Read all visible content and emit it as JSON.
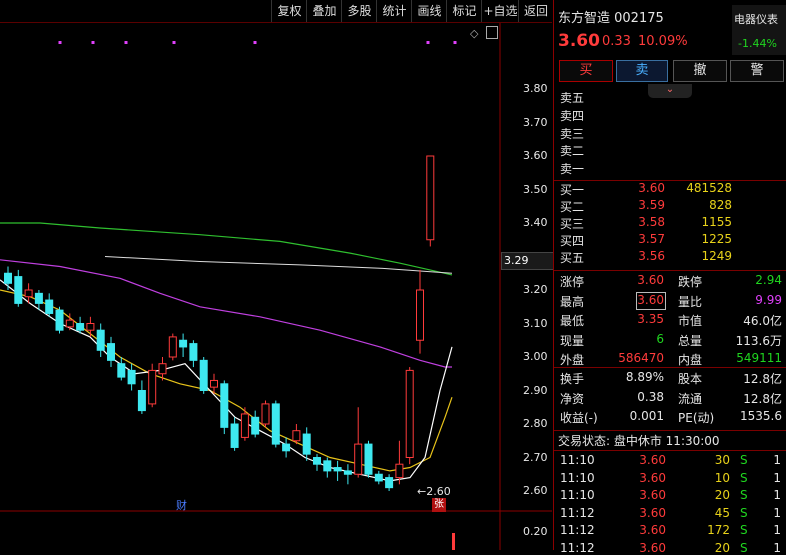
{
  "toolbar": {
    "items": [
      "复权",
      "叠加",
      "多股",
      "统计",
      "画线",
      "标记",
      "+自选",
      "返回"
    ]
  },
  "chart": {
    "yticks": [
      "3.80",
      "3.70",
      "3.60",
      "3.50",
      "3.40",
      "3.30",
      "3.20",
      "3.10",
      "3.00",
      "2.90",
      "2.80",
      "2.70",
      "2.60"
    ],
    "vol_tick": "0.20",
    "current_price_label": "3.29",
    "low_marker": "←2.60",
    "finance_tag": "财",
    "limit_tag": "张"
  },
  "stock": {
    "name": "东方智造 002175",
    "sector": "电器仪表",
    "sector_change": "-1.44%",
    "price": "3.60",
    "change": "0.33",
    "change_pct": "10.09%"
  },
  "buttons": {
    "buy": "买",
    "sell": "卖",
    "cancel": "撤",
    "alert": "警"
  },
  "sell_book": [
    {
      "label": "卖五",
      "price": "",
      "vol": ""
    },
    {
      "label": "卖四",
      "price": "",
      "vol": ""
    },
    {
      "label": "卖三",
      "price": "",
      "vol": ""
    },
    {
      "label": "卖二",
      "price": "",
      "vol": ""
    },
    {
      "label": "卖一",
      "price": "",
      "vol": ""
    }
  ],
  "buy_book": [
    {
      "label": "买一",
      "price": "3.60",
      "vol": "481528"
    },
    {
      "label": "买二",
      "price": "3.59",
      "vol": "828"
    },
    {
      "label": "买三",
      "price": "3.58",
      "vol": "1155"
    },
    {
      "label": "买四",
      "price": "3.57",
      "vol": "1225"
    },
    {
      "label": "买五",
      "price": "3.56",
      "vol": "1249"
    }
  ],
  "stats": [
    {
      "l1": "涨停",
      "v1": "3.60",
      "l2": "跌停",
      "v2": "2.94"
    },
    {
      "l1": "最高",
      "v1": "3.60",
      "l2": "量比",
      "v2": "9.99"
    },
    {
      "l1": "最低",
      "v1": "3.35",
      "l2": "市值",
      "v2": "46.0亿"
    },
    {
      "l1": "现量",
      "v1": "6",
      "l2": "总量",
      "v2": "113.6万"
    },
    {
      "l1": "外盘",
      "v1": "586470",
      "l2": "内盘",
      "v2": "549111"
    }
  ],
  "stats2": [
    {
      "l1": "换手",
      "v1": "8.89%",
      "l2": "股本",
      "v2": "12.8亿"
    },
    {
      "l1": "净资",
      "v1": "0.38",
      "l2": "流通",
      "v2": "12.8亿"
    },
    {
      "l1": "收益(-)",
      "v1": "0.001",
      "l2": "PE(动)",
      "v2": "1535.6"
    }
  ],
  "trade_status": "交易状态: 盘中休市 11:30:00",
  "ticks": [
    {
      "time": "11:10",
      "price": "3.60",
      "vol": "30",
      "side": "S",
      "n": "1"
    },
    {
      "time": "11:10",
      "price": "3.60",
      "vol": "10",
      "side": "S",
      "n": "1"
    },
    {
      "time": "11:10",
      "price": "3.60",
      "vol": "20",
      "side": "S",
      "n": "1"
    },
    {
      "time": "11:12",
      "price": "3.60",
      "vol": "45",
      "side": "S",
      "n": "1"
    },
    {
      "time": "11:12",
      "price": "3.60",
      "vol": "172",
      "side": "S",
      "n": "1"
    },
    {
      "time": "11:12",
      "price": "3.60",
      "vol": "20",
      "side": "S",
      "n": "1"
    }
  ],
  "chart_data": {
    "type": "candlestick",
    "ylim": [
      2.56,
      3.86
    ],
    "candles": [
      {
        "o": 3.25,
        "c": 3.22,
        "h": 3.27,
        "l": 3.2
      },
      {
        "o": 3.24,
        "c": 3.16,
        "h": 3.26,
        "l": 3.15
      },
      {
        "o": 3.18,
        "c": 3.2,
        "h": 3.22,
        "l": 3.16
      },
      {
        "o": 3.19,
        "c": 3.16,
        "h": 3.2,
        "l": 3.14
      },
      {
        "o": 3.17,
        "c": 3.13,
        "h": 3.19,
        "l": 3.12
      },
      {
        "o": 3.14,
        "c": 3.08,
        "h": 3.15,
        "l": 3.07
      },
      {
        "o": 3.09,
        "c": 3.11,
        "h": 3.13,
        "l": 3.08
      },
      {
        "o": 3.1,
        "c": 3.08,
        "h": 3.12,
        "l": 3.07
      },
      {
        "o": 3.08,
        "c": 3.1,
        "h": 3.12,
        "l": 3.06
      },
      {
        "o": 3.08,
        "c": 3.02,
        "h": 3.1,
        "l": 3.0
      },
      {
        "o": 3.04,
        "c": 2.99,
        "h": 3.06,
        "l": 2.97
      },
      {
        "o": 2.98,
        "c": 2.94,
        "h": 3.0,
        "l": 2.93
      },
      {
        "o": 2.96,
        "c": 2.92,
        "h": 2.98,
        "l": 2.9
      },
      {
        "o": 2.9,
        "c": 2.84,
        "h": 2.93,
        "l": 2.83
      },
      {
        "o": 2.86,
        "c": 2.96,
        "h": 2.98,
        "l": 2.85
      },
      {
        "o": 2.95,
        "c": 2.98,
        "h": 3.0,
        "l": 2.93
      },
      {
        "o": 3.0,
        "c": 3.06,
        "h": 3.07,
        "l": 2.99
      },
      {
        "o": 3.05,
        "c": 3.03,
        "h": 3.07,
        "l": 3.0
      },
      {
        "o": 3.04,
        "c": 2.99,
        "h": 3.05,
        "l": 2.97
      },
      {
        "o": 2.99,
        "c": 2.9,
        "h": 3.0,
        "l": 2.89
      },
      {
        "o": 2.91,
        "c": 2.93,
        "h": 2.95,
        "l": 2.89
      },
      {
        "o": 2.92,
        "c": 2.79,
        "h": 2.93,
        "l": 2.77
      },
      {
        "o": 2.8,
        "c": 2.73,
        "h": 2.82,
        "l": 2.72
      },
      {
        "o": 2.76,
        "c": 2.83,
        "h": 2.85,
        "l": 2.75
      },
      {
        "o": 2.82,
        "c": 2.77,
        "h": 2.84,
        "l": 2.76
      },
      {
        "o": 2.8,
        "c": 2.86,
        "h": 2.87,
        "l": 2.79
      },
      {
        "o": 2.86,
        "c": 2.74,
        "h": 2.87,
        "l": 2.73
      },
      {
        "o": 2.74,
        "c": 2.72,
        "h": 2.76,
        "l": 2.7
      },
      {
        "o": 2.75,
        "c": 2.78,
        "h": 2.8,
        "l": 2.74
      },
      {
        "o": 2.77,
        "c": 2.71,
        "h": 2.79,
        "l": 2.69
      },
      {
        "o": 2.7,
        "c": 2.68,
        "h": 2.71,
        "l": 2.66
      },
      {
        "o": 2.69,
        "c": 2.66,
        "h": 2.7,
        "l": 2.64
      },
      {
        "o": 2.67,
        "c": 2.66,
        "h": 2.69,
        "l": 2.63
      },
      {
        "o": 2.66,
        "c": 2.65,
        "h": 2.68,
        "l": 2.62
      },
      {
        "o": 2.65,
        "c": 2.74,
        "h": 2.85,
        "l": 2.64
      },
      {
        "o": 2.74,
        "c": 2.65,
        "h": 2.75,
        "l": 2.64
      },
      {
        "o": 2.65,
        "c": 2.63,
        "h": 2.66,
        "l": 2.62
      },
      {
        "o": 2.64,
        "c": 2.61,
        "h": 2.65,
        "l": 2.6
      },
      {
        "o": 2.64,
        "c": 2.68,
        "h": 2.75,
        "l": 2.62
      },
      {
        "o": 2.7,
        "c": 2.96,
        "h": 2.97,
        "l": 2.68
      },
      {
        "o": 3.05,
        "c": 3.2,
        "h": 3.26,
        "l": 3.01
      },
      {
        "o": 3.35,
        "c": 3.6,
        "h": 3.6,
        "l": 3.33
      }
    ],
    "ma_white": [
      [
        3.03,
        0.9
      ],
      [
        3.0,
        1.7
      ]
    ],
    "current_price": 3.29,
    "low_price": 2.6
  }
}
